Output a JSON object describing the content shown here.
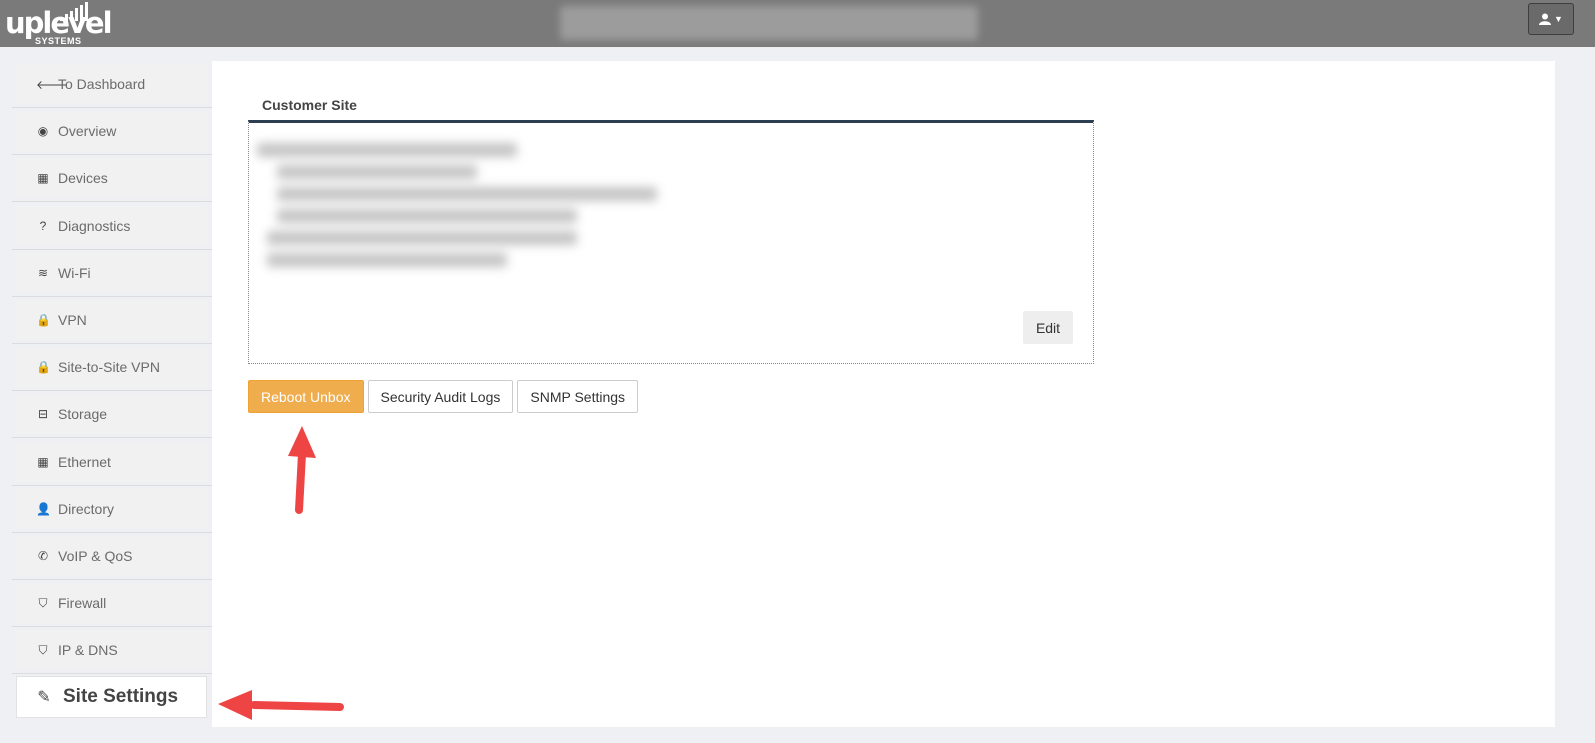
{
  "header": {
    "logo_text": "uplevel",
    "logo_sub": "SYSTEMS",
    "user_icon": "user-icon",
    "caret_icon": "caret-down-icon"
  },
  "sidebar": {
    "items": [
      {
        "label": "To Dashboard",
        "icon": "arrow-left-icon",
        "glyph": "🡐"
      },
      {
        "label": "Overview",
        "icon": "eye-icon",
        "glyph": "◉"
      },
      {
        "label": "Devices",
        "icon": "building-icon",
        "glyph": "▦"
      },
      {
        "label": "Diagnostics",
        "icon": "question-icon",
        "glyph": "?"
      },
      {
        "label": "Wi-Fi",
        "icon": "wifi-icon",
        "glyph": "≋"
      },
      {
        "label": "VPN",
        "icon": "lock-icon",
        "glyph": "🔒"
      },
      {
        "label": "Site-to-Site VPN",
        "icon": "lock-icon",
        "glyph": "🔒"
      },
      {
        "label": "Storage",
        "icon": "hdd-icon",
        "glyph": "⊟"
      },
      {
        "label": "Ethernet",
        "icon": "building-icon",
        "glyph": "▦"
      },
      {
        "label": "Directory",
        "icon": "user-icon",
        "glyph": "👤"
      },
      {
        "label": "VoIP & QoS",
        "icon": "phone-icon",
        "glyph": "✆"
      },
      {
        "label": "Firewall",
        "icon": "shield-icon",
        "glyph": "⛉"
      },
      {
        "label": "IP & DNS",
        "icon": "shield-icon",
        "glyph": "⛉"
      },
      {
        "label": "Site Settings",
        "icon": "edit-icon",
        "glyph": "✎",
        "active": true
      }
    ]
  },
  "main": {
    "panel_title": "Customer Site",
    "edit_label": "Edit",
    "buttons": {
      "reboot": "Reboot Unbox",
      "audit": "Security Audit Logs",
      "snmp": "SNMP Settings"
    }
  },
  "colors": {
    "accent": "#f0ad4e",
    "topbar": "#7a7a7a",
    "annotation_arrow": "#ef4444"
  }
}
